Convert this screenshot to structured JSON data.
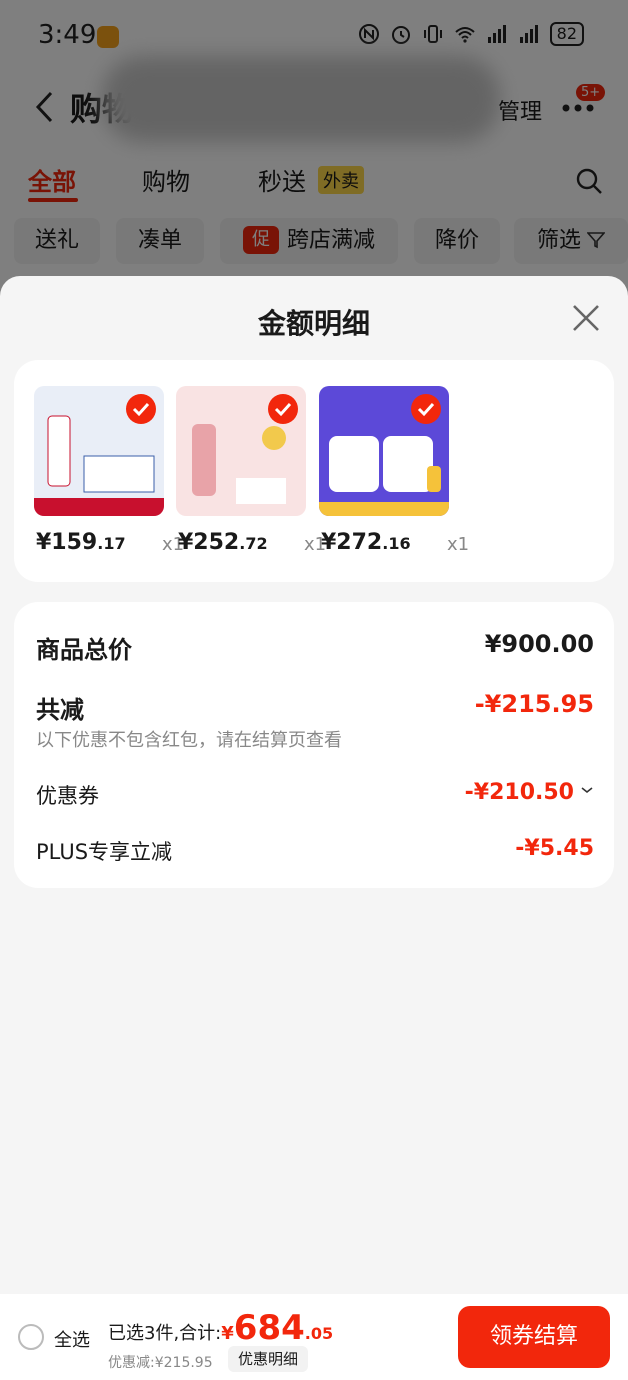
{
  "status_bar": {
    "time": "3:49",
    "battery": "82"
  },
  "nav": {
    "title": "购物",
    "manage_label": "管理",
    "badge": "5+"
  },
  "tabs": [
    {
      "label": "全部"
    },
    {
      "label": "购物"
    },
    {
      "label": "秒送",
      "tag": "外卖"
    }
  ],
  "chips": [
    "送礼",
    "凑单",
    "跨店满减",
    "降价",
    "筛选"
  ],
  "chip_promo_mark": "促",
  "sheet": {
    "title": "金额明细",
    "products": [
      {
        "price_int": "¥159",
        "price_dec": ".17",
        "qty": "x1",
        "color": "#e9eef7",
        "accent": "#c8102e"
      },
      {
        "price_int": "¥252",
        "price_dec": ".72",
        "qty": "x1",
        "color": "#f9e3e3",
        "accent": "#e8a3a8"
      },
      {
        "price_int": "¥272",
        "price_dec": ".16",
        "qty": "x1",
        "color": "#5c49d8",
        "accent": "#f5c23a"
      }
    ],
    "summary": {
      "total_label": "商品总价",
      "total_value": "¥900.00",
      "discount_label": "共减",
      "discount_value": "-¥215.95",
      "discount_note": "以下优惠不包含红包，请在结算页查看",
      "coupon_label": "优惠券",
      "coupon_value": "-¥210.50",
      "plus_label": "PLUS专享立减",
      "plus_value": "-¥5.45"
    }
  },
  "bottom": {
    "select_all": "全选",
    "prefix": "已选3件,合计:",
    "currency": "¥",
    "total_int": "684",
    "total_dec": ".05",
    "saved": "优惠减:¥215.95",
    "detail_btn": "优惠明细",
    "checkout": "领券结算"
  },
  "colors": {
    "brand_red": "#f2270c",
    "takeout_yellow": "#ffd84a"
  }
}
